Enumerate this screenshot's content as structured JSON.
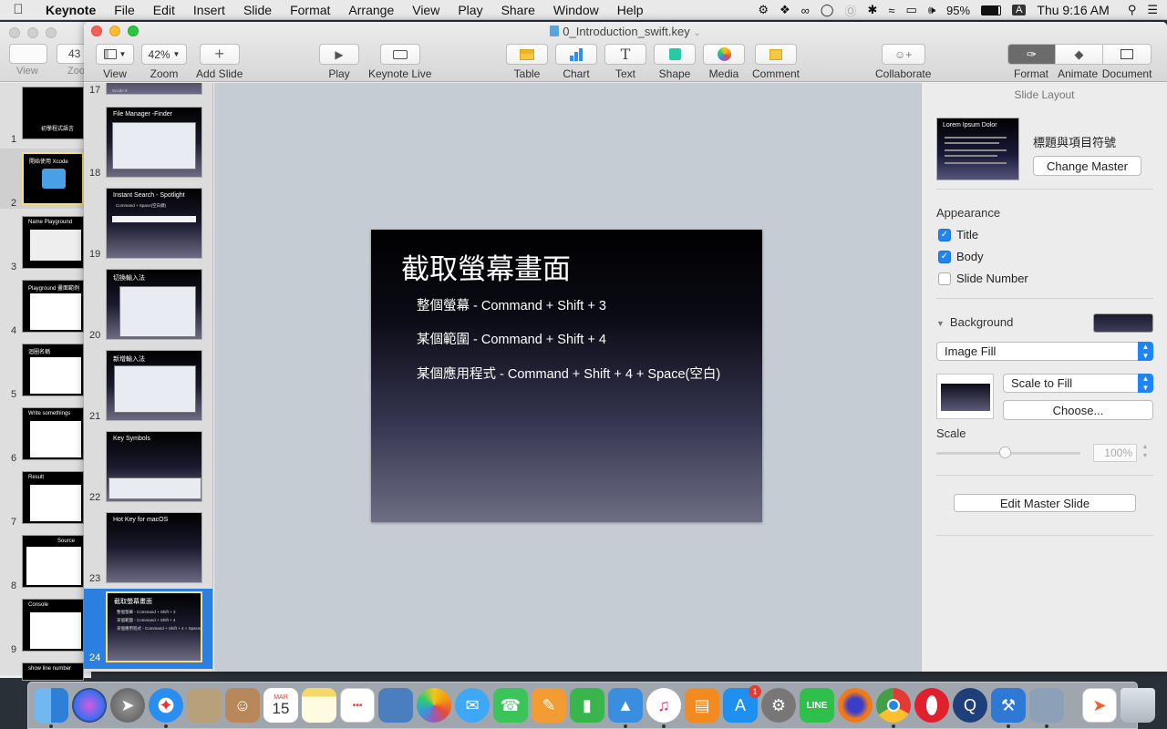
{
  "menubar": {
    "app_name": "Keynote",
    "items": [
      "File",
      "Edit",
      "Insert",
      "Slide",
      "Format",
      "Arrange",
      "View",
      "Play",
      "Share",
      "Window",
      "Help"
    ],
    "battery": "95%",
    "clock": "Thu 9:16 AM",
    "user_initial": "A"
  },
  "background_window": {
    "zoom_partial": "43",
    "view_label": "View",
    "zoom_label": "Zoo",
    "slides": [
      {
        "num": "1",
        "title": "初學程式語言"
      },
      {
        "num": "2",
        "title": "開始使用 Xcode"
      },
      {
        "num": "3",
        "title": "Name Playground"
      },
      {
        "num": "4",
        "title": "Playground 畫面範例"
      },
      {
        "num": "5",
        "title": "迴圈名稱"
      },
      {
        "num": "6",
        "title": "Write somethings"
      },
      {
        "num": "7",
        "title": "Result"
      },
      {
        "num": "8",
        "title": "Source"
      },
      {
        "num": "9",
        "title": "Console"
      },
      {
        "num": "",
        "title": "show line number"
      }
    ]
  },
  "window": {
    "title": "0_Introduction_swift.key",
    "toolbar": {
      "view": "View",
      "zoom_value": "42%",
      "zoom": "Zoom",
      "add_slide": "Add Slide",
      "play": "Play",
      "keynote_live": "Keynote Live",
      "table": "Table",
      "chart": "Chart",
      "text": "Text",
      "shape": "Shape",
      "media": "Media",
      "comment": "Comment",
      "collaborate": "Collaborate",
      "format": "Format",
      "animate": "Animate",
      "document": "Document"
    }
  },
  "navigator": {
    "slides": [
      {
        "num": "17",
        "title": "Xcode 9"
      },
      {
        "num": "18",
        "title": "File Manager -Finder"
      },
      {
        "num": "19",
        "title": "Instant Search - Spotlight",
        "sub": "Command + Space(空白鍵)"
      },
      {
        "num": "20",
        "title": "切換輸入法"
      },
      {
        "num": "21",
        "title": "新增輸入法"
      },
      {
        "num": "22",
        "title": "Key Symbols"
      },
      {
        "num": "23",
        "title": "Hot Key for macOS"
      },
      {
        "num": "24",
        "title": "截取螢幕畫面",
        "selected": true
      }
    ]
  },
  "slide": {
    "title": "截取螢幕畫面",
    "bullets": [
      "整個螢幕 - Command + Shift + 3",
      "某個範圍 - Command + Shift + 4",
      "某個應用程式 - Command + Shift + 4 + Space(空白)"
    ]
  },
  "inspector": {
    "header": "Slide Layout",
    "layout_thumb_title": "Lorem Ipsum Dolor",
    "layout_name": "標題與項目符號",
    "change_master": "Change Master",
    "appearance": "Appearance",
    "checks": [
      {
        "label": "Title",
        "checked": true
      },
      {
        "label": "Body",
        "checked": true
      },
      {
        "label": "Slide Number",
        "checked": false
      }
    ],
    "background": "Background",
    "fill_type": "Image Fill",
    "scale_mode": "Scale to Fill",
    "choose": "Choose...",
    "scale_label": "Scale",
    "scale_value": "100%",
    "edit_master": "Edit Master Slide"
  },
  "dock": {
    "apps": [
      "Finder",
      "Siri",
      "Launchpad",
      "Safari",
      "Preview",
      "Contacts",
      "Calendar",
      "Notes",
      "Reminders",
      "Photo Booth",
      "Photos",
      "Messages",
      "FaceTime",
      "Pages",
      "Numbers",
      "Keynote",
      "iTunes",
      "iBooks",
      "App Store",
      "System Preferences",
      "LINE",
      "Firefox",
      "Chrome",
      "Opera",
      "QuickTime",
      "Xcode",
      "Preview2",
      "Swift Playgrounds",
      "Trash"
    ],
    "calendar_month": "MAR",
    "calendar_day": "15",
    "line_label": "LINE",
    "appstore_badge": "1"
  }
}
